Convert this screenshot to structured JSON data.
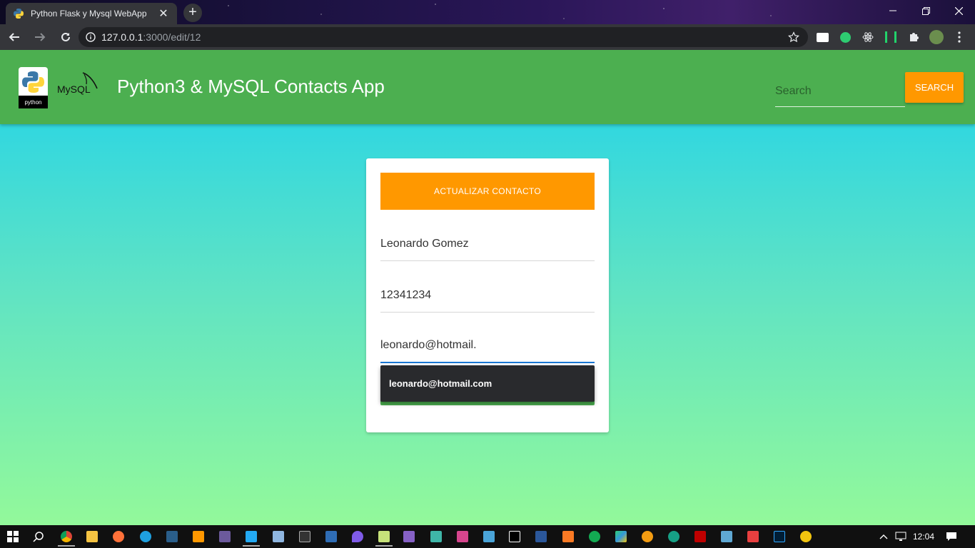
{
  "browser": {
    "tab_title": "Python Flask y Mysql WebApp",
    "tab_close": "✕",
    "new_tab": "+",
    "url_host": "127.0.0.1",
    "url_rest": ":3000/edit/12"
  },
  "navbar": {
    "title": "Python3 & MySQL Contacts App",
    "python_logo_text": "python",
    "mysql_logo_text": "MySQL",
    "search_placeholder": "Search",
    "search_button": "SEARCH"
  },
  "form": {
    "header": "ACTUALIZAR CONTACTO",
    "fullname": "Leonardo Gomez",
    "phone": "12341234",
    "email": "leonardo@hotmail.",
    "autocomplete_suggestion": "leonardo@hotmail.com"
  },
  "taskbar": {
    "time": "12:04"
  },
  "colors": {
    "navbar": "#4caf50",
    "accent": "#ff9800",
    "gradient_top": "#1dd2ec",
    "gradient_bottom": "#93f99a"
  }
}
